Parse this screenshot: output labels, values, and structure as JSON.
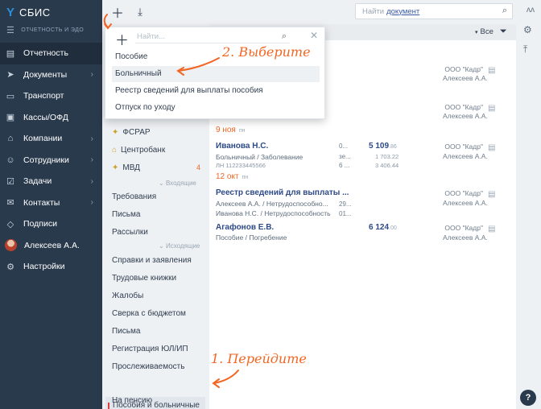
{
  "app": {
    "brand": "СБИС",
    "company": "ОТЧЕТНОСТЬ И ЭДО"
  },
  "sidebar": {
    "items": [
      {
        "label": "Отчетность",
        "icon": "report-icon",
        "chevron": false
      },
      {
        "label": "Документы",
        "icon": "paper-plane-icon",
        "chevron": true
      },
      {
        "label": "Транспорт",
        "icon": "truck-icon",
        "chevron": false
      },
      {
        "label": "Кассы/ОФД",
        "icon": "cash-register-icon",
        "chevron": false
      },
      {
        "label": "Компании",
        "icon": "building-icon",
        "chevron": true
      },
      {
        "label": "Сотрудники",
        "icon": "people-icon",
        "chevron": true
      },
      {
        "label": "Задачи",
        "icon": "checklist-icon",
        "chevron": true
      },
      {
        "label": "Контакты",
        "icon": "chat-icon",
        "chevron": true
      },
      {
        "label": "Подписи",
        "icon": "tag-icon",
        "chevron": false
      },
      {
        "label": "Алексеев А.А.",
        "icon": "avatar",
        "chevron": false
      },
      {
        "label": "Настройки",
        "icon": "gear-icon",
        "chevron": false
      }
    ]
  },
  "toolbar": {
    "search_placeholder": "Найти",
    "search_link": "документ",
    "right_glyph": "ᴧᴧ"
  },
  "filter": {
    "label": "Все"
  },
  "registry": {
    "top_items": [
      {
        "label": "ФСРАР",
        "count": ""
      },
      {
        "label": "Центробанк",
        "count": ""
      },
      {
        "label": "МВД",
        "count": "4"
      }
    ],
    "incoming_label": "Входящие",
    "incoming_items": [
      "Требования",
      "Письма",
      "Рассылки"
    ],
    "outgoing_label": "Исходящие",
    "outgoing_items": [
      "Справки и заявления",
      "Трудовые книжки",
      "Жалобы",
      "Сверка с бюджетом",
      "Письма",
      "Регистрация ЮЛ/ИП",
      "Прослеживаемость",
      "Пособия и больничные",
      "На пенсию"
    ]
  },
  "popup": {
    "search_placeholder": "Найти...",
    "options": [
      "Пособие",
      "Больничный",
      "Реестр сведений для выплаты пособия",
      "Отпуск по уходу"
    ]
  },
  "documents": {
    "row_a": {
      "org": "ООО \"Кадр\"",
      "person": "Алексеев А.А."
    },
    "row_b": {
      "org": "ООО \"Кадр\"",
      "person": "Алексеев А.А."
    },
    "date1": {
      "day": "9 ноя",
      "weekday": "пн"
    },
    "doc1": {
      "title": "Иванова Н.С.",
      "subtitle": "Больничный / Заболевание",
      "number": "ЛН 112233445566",
      "mid1": "0...",
      "mid2": "зе...",
      "mid3": "6 ...",
      "amount": "5 109",
      "amount_cents": ".86",
      "amount_line2": "1 703.22",
      "amount_line3": "3 406.44",
      "org": "ООО \"Кадр\"",
      "person": "Алексеев А.А."
    },
    "date2": {
      "day": "12 окт",
      "weekday": "пн"
    },
    "doc2": {
      "title": "Реестр сведений для выплаты ...",
      "line1": "Алексеев А.А. / Нетрудоспособно...",
      "line2": "Иванова Н.С. / Нетрудоспособность",
      "mid1": "29...",
      "mid2": "01...",
      "org": "ООО \"Кадр\"",
      "person": "Алексеев А.А."
    },
    "doc3": {
      "title": "Агафонов Е.В.",
      "subtitle": "Пособие / Погребение",
      "amount": "6 124",
      "amount_cents": ".00",
      "org": "ООО \"Кадр\"",
      "person": "Алексеев А.А."
    }
  },
  "annotations": {
    "step1": "1. Перейдите",
    "step2": "2. Выберите"
  },
  "help": {
    "label": "?"
  },
  "colors": {
    "accent": "#f26522",
    "sidebar": "#2a3a4d",
    "link": "#2d4a86"
  }
}
